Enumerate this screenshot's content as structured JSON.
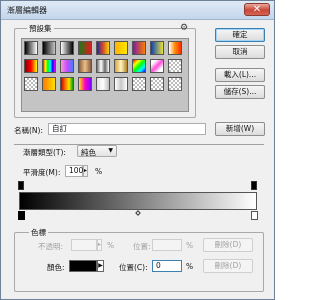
{
  "window": {
    "title": "漸層編輯器",
    "close_glyph": "✕"
  },
  "presets": {
    "legend": "預設集",
    "menu_icon": "gear-icon",
    "swatches": [
      {
        "bg": "linear-gradient(to right,#000,#fff)"
      },
      {
        "bg": "linear-gradient(to right,#000,#ffffff00)"
      },
      {
        "bg": "linear-gradient(to right,#fff,#000)"
      },
      {
        "bg": "linear-gradient(to right,#1b7a1b,#e01b1b)"
      },
      {
        "bg": "linear-gradient(to right,#1a2ba8,#d94b1f,#f2d31a)"
      },
      {
        "bg": "linear-gradient(to right,#ffb300,#ffe600)"
      },
      {
        "bg": "linear-gradient(to right,#7a1f9e,#ff7b00)"
      },
      {
        "bg": "linear-gradient(to right,#0b3fb8,#e8e33b)"
      },
      {
        "bg": "linear-gradient(to right,#ffffff,#ff8a00,#ff2b00)"
      },
      {
        "bg": "linear-gradient(to right,#8b0000,#ff0000,#ffff00)"
      },
      {
        "bg": "linear-gradient(to right,#ff0000,#ffff00,#00ff00,#00ffff,#0000ff,#ff00ff)"
      },
      {
        "bg": "linear-gradient(to right,#ff9bd1,#c44bff,#4b7bff)"
      },
      {
        "bg": "linear-gradient(to right,#8a5a3a,#e8c08a,#8a5a3a)"
      },
      {
        "bg": "linear-gradient(to right,#6a6a6a,#ffffff,#6a6a6a,#ffffff)"
      },
      {
        "bg": "linear-gradient(to right,#d8a53a,#fff3c4,#b58227)"
      },
      {
        "bg": "linear-gradient(135deg,#ff0000,#ffff00,#00ff00,#00ffff,#0000ff)"
      },
      {
        "bg": "linear-gradient(135deg,#fff 20%,#ff4fd8 50%,#fff 80%)"
      },
      {
        "bg": "checker"
      },
      {
        "bg": "checker"
      },
      {
        "bg": "linear-gradient(to right,#ff7a00,#ffe100)"
      },
      {
        "bg": "linear-gradient(to right,#c00000,#ff6a00,#ffe600,#00a000)"
      },
      {
        "bg": "linear-gradient(to right,#ffe600,#ff00c8,#7a00ff)"
      },
      {
        "bg": "linear-gradient(to right,#e0e0e0,#ffffff,#bdbdbd)"
      },
      {
        "bg": "linear-gradient(to right,#ffffff,#c8c8c8,#ffffff)"
      },
      {
        "bg": "checker"
      },
      {
        "bg": "checker"
      },
      {
        "bg": "checker"
      }
    ]
  },
  "buttons": {
    "ok": "確定",
    "cancel": "取消",
    "load": "載入(L)...",
    "save": "儲存(S)...",
    "new": "新增(W)"
  },
  "name_field": {
    "label": "名稱(N):",
    "value": "自訂"
  },
  "gradient": {
    "type_label": "漸層類型(T):",
    "type_value": "純色",
    "smoothness_label": "平滑度(M):",
    "smoothness_value": "100",
    "smoothness_unit": "%",
    "start_color": "#000000",
    "end_color": "#ffffff",
    "midpoint_percent": 50
  },
  "color_stops": {
    "legend": "色標",
    "opacity_label": "不透明:",
    "opacity_unit": "%",
    "opacity_location_label": "位置:",
    "opacity_location_unit": "%",
    "opacity_delete": "刪除(D)",
    "color_label": "顏色:",
    "color_value": "#000000",
    "color_location_label": "位置(C):",
    "color_location_value": "0",
    "color_location_unit": "%",
    "color_delete": "刪除(D)"
  }
}
